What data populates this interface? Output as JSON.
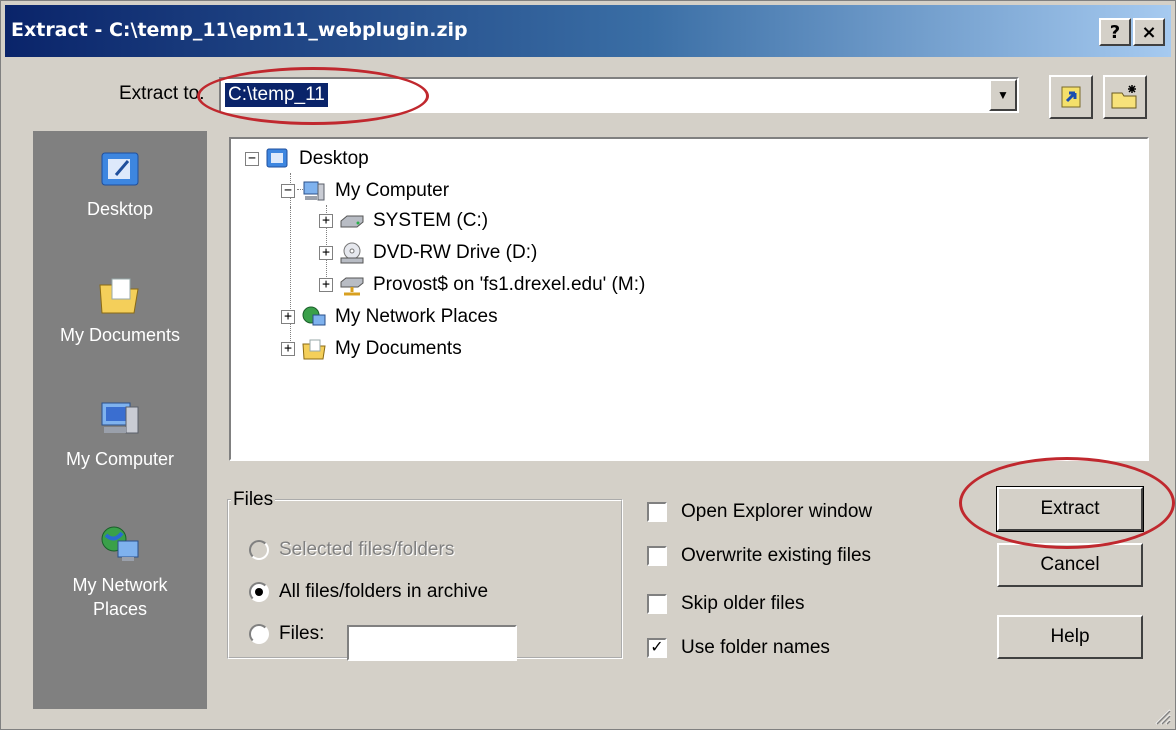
{
  "window": {
    "title": "Extract - C:\\temp_11\\epm11_webplugin.zip",
    "help_label": "?",
    "close_label": "×"
  },
  "extract_to": {
    "label": "Extract to:",
    "value": "C:\\temp_11"
  },
  "places": [
    {
      "label": "Desktop",
      "icon": "desktop-icon"
    },
    {
      "label": "My Documents",
      "icon": "documents-folder-icon"
    },
    {
      "label": "My Computer",
      "icon": "computer-icon"
    },
    {
      "label": "My Network Places",
      "icon": "network-globe-icon"
    }
  ],
  "tree": {
    "desktop": "Desktop",
    "my_computer": "My Computer",
    "system": "SYSTEM (C:)",
    "dvd": "DVD-RW Drive (D:)",
    "provost": "Provost$ on 'fs1.drexel.edu' (M:)",
    "network": "My Network Places",
    "my_documents": "My Documents"
  },
  "files_group": {
    "legend": "Files",
    "selected": "Selected files/folders",
    "all": "All files/folders in archive",
    "files": "Files:",
    "files_value": ""
  },
  "options": {
    "open_explorer": "Open Explorer window",
    "overwrite": "Overwrite existing files",
    "skip_older": "Skip older files",
    "use_folder_names": "Use folder names"
  },
  "buttons": {
    "extract": "Extract",
    "cancel": "Cancel",
    "help": "Help"
  },
  "colors": {
    "highlight": "#c0282e",
    "titlebar": "#0a246a",
    "face": "#d4d0c8"
  }
}
